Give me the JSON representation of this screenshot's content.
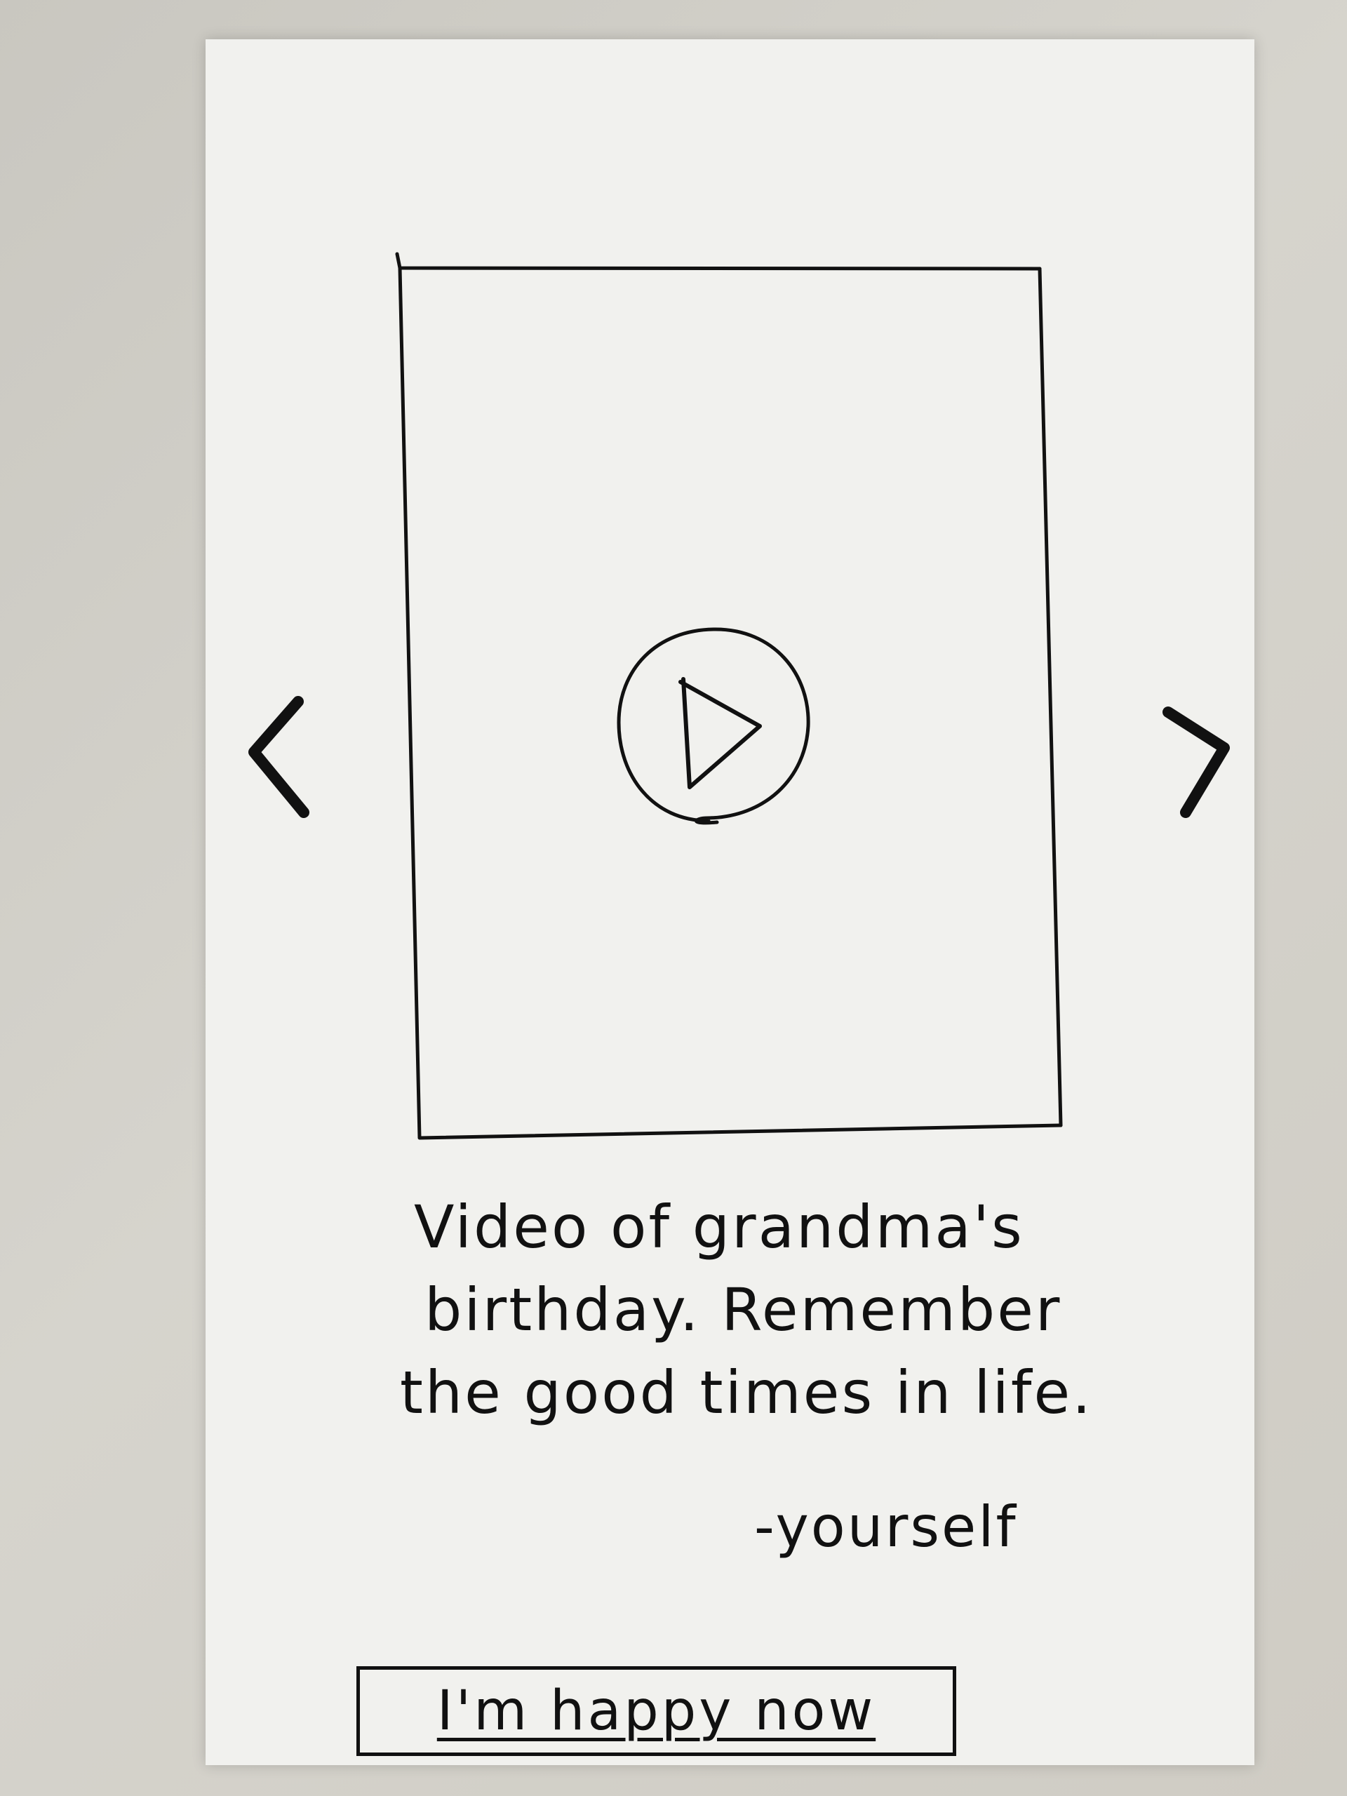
{
  "screen": {
    "caption_lines": [
      "Video of grandma's",
      "birthday. Remember",
      "the good times in life."
    ],
    "signature": "-yourself",
    "happy_button_label": "I'm happy now",
    "icons": {
      "previous": "chevron-left-icon",
      "next": "chevron-right-icon",
      "play": "play-icon"
    }
  }
}
